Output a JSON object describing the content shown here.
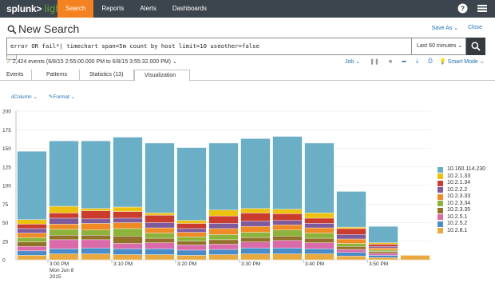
{
  "app": {
    "logo_word": "splunk>",
    "logo_suffix": "light",
    "nav": [
      {
        "label": "Search",
        "active": true
      },
      {
        "label": "Reports",
        "active": false
      },
      {
        "label": "Alerts",
        "active": false
      },
      {
        "label": "Dashboards",
        "active": false
      }
    ],
    "icons": {
      "help": "question-circle-icon",
      "menu": "hamburger-menu-icon"
    }
  },
  "header": {
    "title": "New Search",
    "save_as_label": "Save As",
    "close_label": "Close"
  },
  "search": {
    "query": "error OR fail*| timechart span=5m count by host limit=10 useother=false",
    "time_range": "Last 60 minutes"
  },
  "status": {
    "events_text": "2,424 events (6/8/15 2:55:00.000 PM to 6/8/15 3:55:32.000 PM)",
    "job_label": "Job",
    "smart_mode_label": "Smart Mode"
  },
  "tabs": [
    {
      "label": "Events",
      "active": false
    },
    {
      "label": "Patterns",
      "active": false
    },
    {
      "label": "Statistics (13)",
      "active": false
    },
    {
      "label": "Visualization",
      "active": true
    }
  ],
  "viz_controls": {
    "column_label": "Column",
    "format_label": "Format"
  },
  "colors": {
    "topbar": "#3c444d",
    "accent": "#f58220",
    "link": "#1e6fb4"
  },
  "chart_data": {
    "type": "bar",
    "stacked": true,
    "ylim": [
      0,
      200
    ],
    "y_ticks": [
      0,
      25,
      50,
      75,
      100,
      125,
      150,
      175,
      200
    ],
    "x_tick_labels": [
      "3:00 PM",
      "3:10 PM",
      "3:20 PM",
      "3:30 PM",
      "3:40 PM",
      "3:50 PM"
    ],
    "x_tick_sublabels": [
      "Mon Jun 8",
      "2015"
    ],
    "categories": [
      "2:55 PM",
      "3:00 PM",
      "3:05 PM",
      "3:10 PM",
      "3:15 PM",
      "3:20 PM",
      "3:25 PM",
      "3:30 PM",
      "3:35 PM",
      "3:40 PM",
      "3:45 PM",
      "3:50 PM",
      "3:55 PM"
    ],
    "legend_position": "right",
    "grid": true,
    "series": [
      {
        "name": "10.2.8.1",
        "color": "#e9a93f",
        "values": [
          6,
          8,
          8,
          7,
          7,
          6,
          7,
          8,
          8,
          8,
          5,
          3,
          6
        ]
      },
      {
        "name": "10.2.5.2",
        "color": "#4a8cc7",
        "values": [
          6,
          7,
          8,
          8,
          8,
          7,
          7,
          8,
          8,
          7,
          5,
          3,
          0
        ]
      },
      {
        "name": "10.2.5.1",
        "color": "#da6aaa",
        "values": [
          6,
          12,
          11,
          7,
          8,
          7,
          7,
          8,
          10,
          8,
          4,
          3,
          0
        ]
      },
      {
        "name": "10.2.3.35",
        "color": "#92722a",
        "values": [
          6,
          6,
          6,
          10,
          6,
          5,
          6,
          6,
          6,
          6,
          4,
          2,
          0
        ]
      },
      {
        "name": "10.2.3.34",
        "color": "#8cb43c",
        "values": [
          6,
          8,
          7,
          10,
          7,
          6,
          7,
          7,
          8,
          7,
          4,
          2,
          0
        ]
      },
      {
        "name": "10.2.3.33",
        "color": "#f08a24",
        "values": [
          6,
          7,
          9,
          8,
          7,
          6,
          8,
          8,
          7,
          7,
          6,
          3,
          0
        ]
      },
      {
        "name": "10.2.2.2",
        "color": "#7d5b9c",
        "values": [
          6,
          8,
          6,
          6,
          7,
          5,
          7,
          7,
          6,
          6,
          6,
          2,
          0
        ]
      },
      {
        "name": "10.2.1.34",
        "color": "#ca3c2e",
        "values": [
          6,
          7,
          11,
          9,
          10,
          7,
          10,
          11,
          9,
          7,
          8,
          3,
          0
        ]
      },
      {
        "name": "10.2.1.33",
        "color": "#edc10f",
        "values": [
          6,
          9,
          3,
          6,
          3,
          4,
          8,
          6,
          6,
          7,
          2,
          2,
          0
        ]
      },
      {
        "name": "10.160.114.230",
        "color": "#6aafc6",
        "values": [
          92,
          88,
          91,
          94,
          94,
          98,
          90,
          94,
          98,
          94,
          48,
          22,
          0
        ]
      }
    ]
  }
}
